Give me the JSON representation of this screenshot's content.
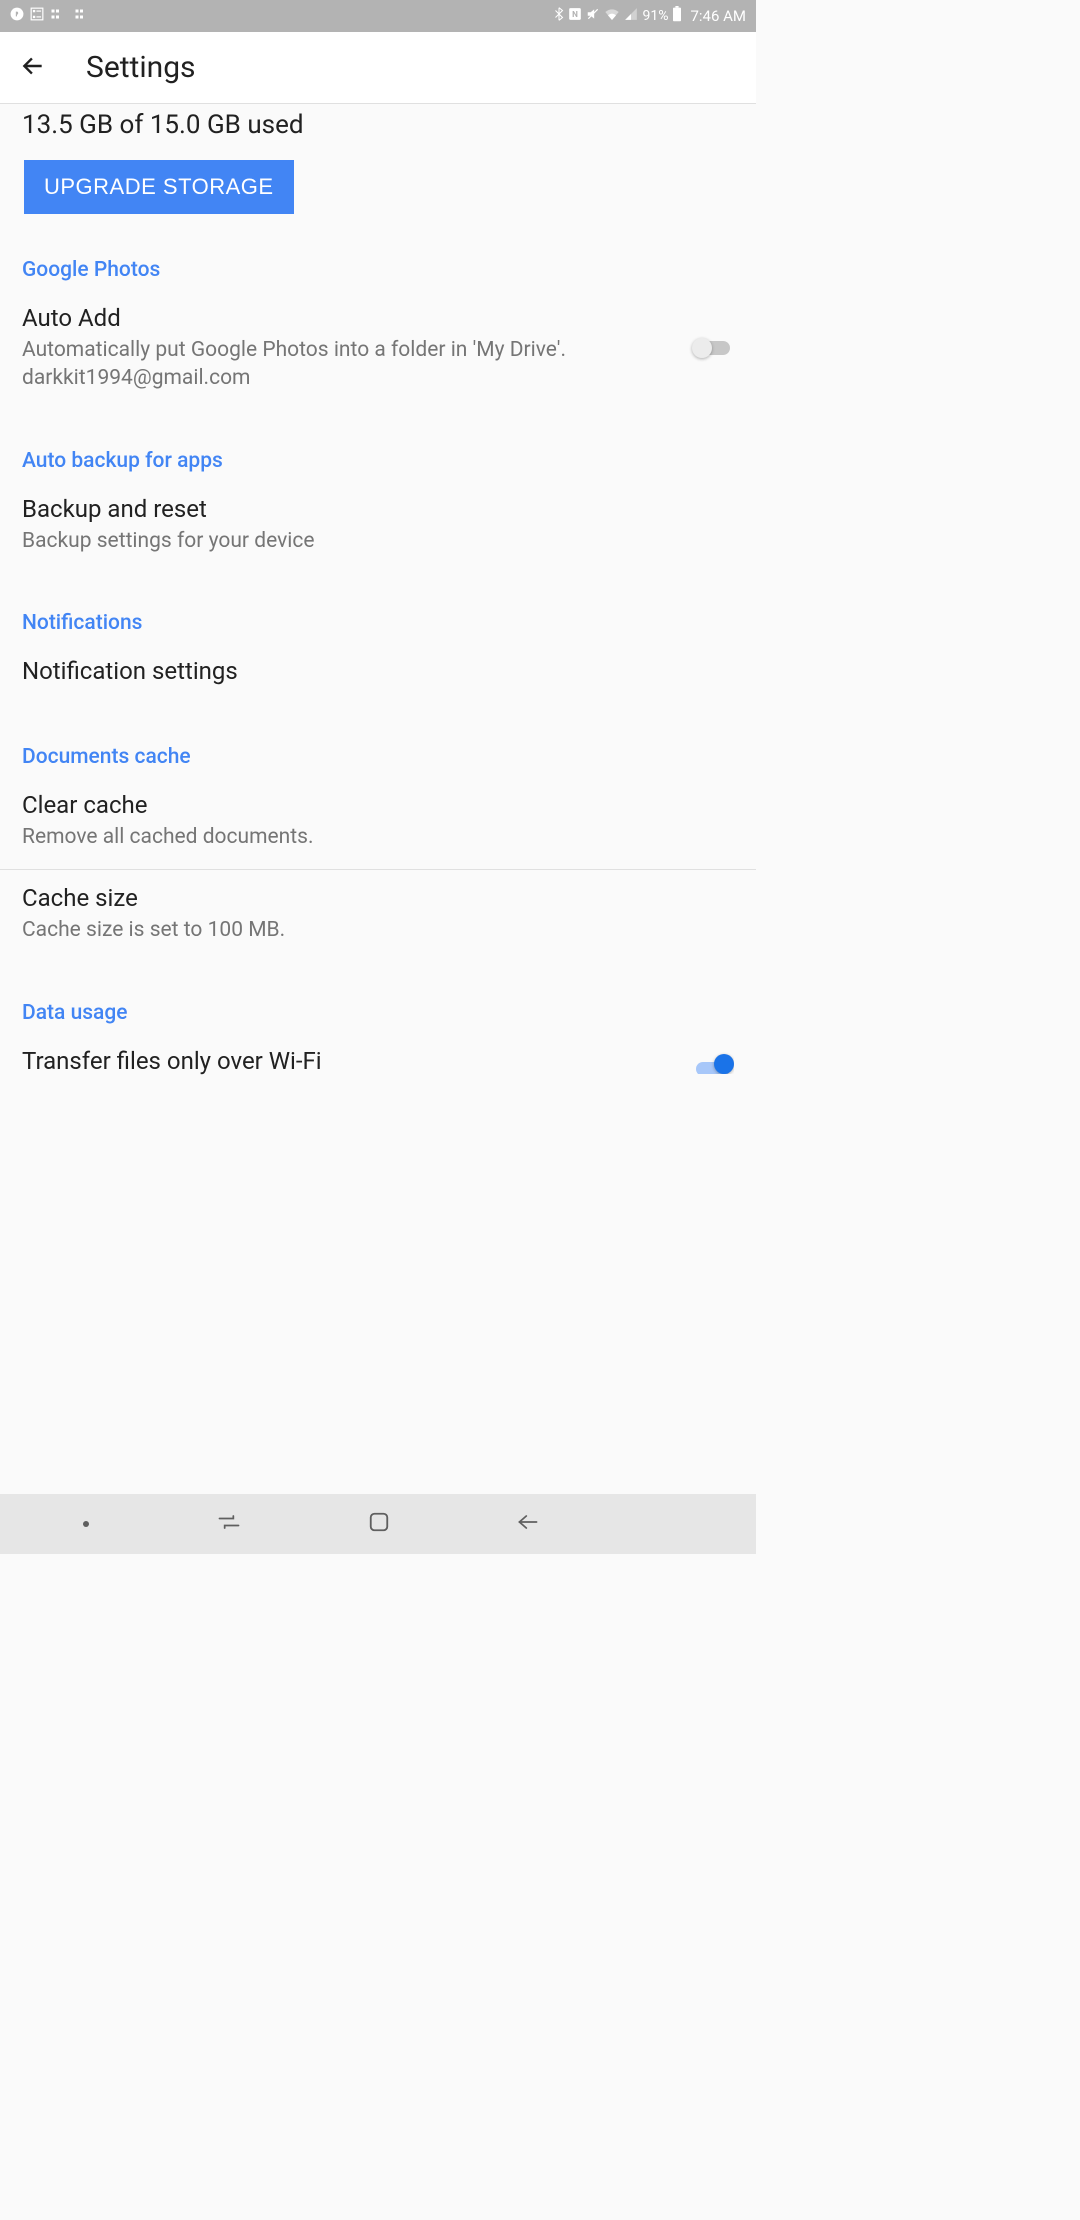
{
  "status_bar": {
    "battery": "91%",
    "time": "7:46 AM"
  },
  "header": {
    "title": "Settings"
  },
  "storage": {
    "usage_text": "13.5 GB of 15.0 GB used",
    "upgrade_label": "UPGRADE STORAGE"
  },
  "sections": {
    "google_photos": {
      "header": "Google Photos",
      "auto_add": {
        "title": "Auto Add",
        "subtitle": "Automatically put Google Photos into a folder in 'My Drive'. darkkit1994@gmail.com"
      }
    },
    "auto_backup": {
      "header": "Auto backup for apps",
      "backup_reset": {
        "title": "Backup and reset",
        "subtitle": "Backup settings for your device"
      }
    },
    "notifications": {
      "header": "Notifications",
      "notification_settings": {
        "title": "Notification settings"
      }
    },
    "documents_cache": {
      "header": "Documents cache",
      "clear_cache": {
        "title": "Clear cache",
        "subtitle": "Remove all cached documents."
      },
      "cache_size": {
        "title": "Cache size",
        "subtitle": "Cache size is set to 100 MB."
      }
    },
    "data_usage": {
      "header": "Data usage",
      "wifi_only": {
        "title": "Transfer files only over Wi-Fi"
      }
    }
  }
}
